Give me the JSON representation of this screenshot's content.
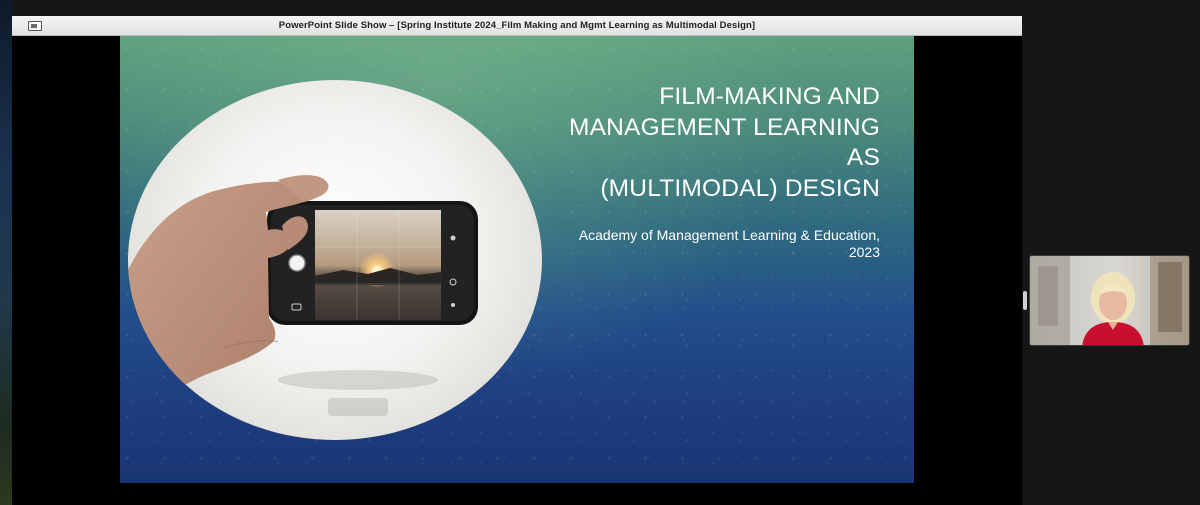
{
  "window": {
    "title": "PowerPoint Slide Show  –  [Spring Institute 2024_Film Making and Mgmt Learning as Multimodal Design]"
  },
  "slide": {
    "title_lines": [
      "FILM-MAKING AND",
      "MANAGEMENT LEARNING",
      "AS",
      "(MULTIMODAL) DESIGN"
    ],
    "subtitle_lines": [
      "Academy of Management Learning & Education,",
      "2023"
    ],
    "image": "hand-holding-smartphone-photo"
  },
  "participant": {
    "video": "participant-video",
    "description_icon": "person-video-icon"
  },
  "colors": {
    "slide_top": "#5fa07e",
    "slide_bottom": "#1b3574",
    "title_text": "#ffffff",
    "participant_top": "#c8102e"
  }
}
